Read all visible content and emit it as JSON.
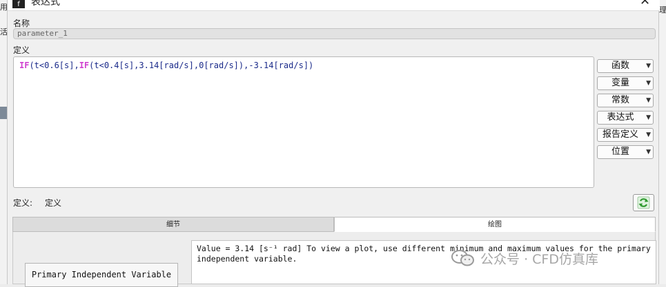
{
  "background": {
    "left_glyph_1": "用",
    "left_glyph_2": "活",
    "right_glyph_1": "理"
  },
  "window": {
    "title": "表达式",
    "icon_letter": "f",
    "close_glyph": "✕"
  },
  "name_section": {
    "label": "名称",
    "value": "parameter_1"
  },
  "definition_section": {
    "label": "定义",
    "tokens": [
      {
        "text": "IF",
        "kw": true
      },
      {
        "text": "(t<0.6[s],",
        "kw": false
      },
      {
        "text": "IF",
        "kw": true
      },
      {
        "text": "(t<0.4[s],3.14[rad/s],0[rad/s]),-3.14[rad/s])",
        "kw": false
      }
    ]
  },
  "side_buttons": [
    {
      "name": "functions",
      "label": "函数"
    },
    {
      "name": "variables",
      "label": "变量"
    },
    {
      "name": "constants",
      "label": "常数"
    },
    {
      "name": "expressions",
      "label": "表达式"
    },
    {
      "name": "report-definitions",
      "label": "报告定义"
    },
    {
      "name": "location",
      "label": "位置"
    }
  ],
  "definition_status": {
    "key": "定义:",
    "value": "定义"
  },
  "tabs": [
    {
      "name": "details",
      "label": "细节",
      "active": false
    },
    {
      "name": "plot",
      "label": "绘图",
      "active": true
    }
  ],
  "plot_panel": {
    "independent_variable_button": "Primary Independent Variable",
    "message": "Value = 3.14 [s⁻¹ rad] To view a plot, use different minimum and maximum values for the primary independent variable."
  },
  "watermark": {
    "text": "公众号 · CFD仿真库"
  },
  "colors": {
    "keyword": "#d040d0",
    "expression_text": "#1a2a8a",
    "refresh_green": "#2f9a2f"
  }
}
